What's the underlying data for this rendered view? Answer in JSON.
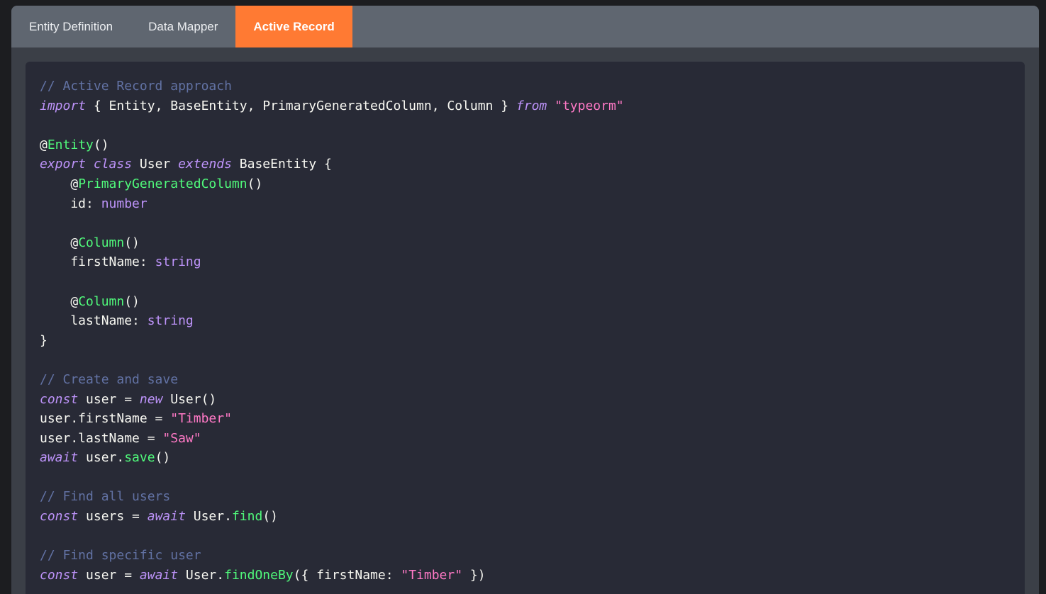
{
  "tabs": [
    {
      "label": "Entity Definition",
      "active": false
    },
    {
      "label": "Data Mapper",
      "active": false
    },
    {
      "label": "Active Record",
      "active": true
    }
  ],
  "colors": {
    "accent": "#ff7a33",
    "tabbar": "#5f6670",
    "code_bg": "#282a36",
    "comment": "#6272a4",
    "keyword": "#bd93f9",
    "string": "#ff79c6",
    "function": "#50fa7b",
    "text": "#f8f8f2"
  },
  "code": {
    "language": "typescript",
    "lines": [
      [
        {
          "t": "// Active Record approach",
          "c": "c"
        }
      ],
      [
        {
          "t": "import",
          "c": "k"
        },
        {
          "t": " { Entity, BaseEntity, PrimaryGeneratedColumn, Column } "
        },
        {
          "t": "from",
          "c": "k"
        },
        {
          "t": " "
        },
        {
          "t": "\"typeorm\"",
          "c": "s"
        }
      ],
      [],
      [
        {
          "t": "@"
        },
        {
          "t": "Entity",
          "c": "f"
        },
        {
          "t": "()"
        }
      ],
      [
        {
          "t": "export",
          "c": "k"
        },
        {
          "t": " "
        },
        {
          "t": "class",
          "c": "k"
        },
        {
          "t": " User "
        },
        {
          "t": "extends",
          "c": "k"
        },
        {
          "t": " BaseEntity {"
        }
      ],
      [
        {
          "t": "    @"
        },
        {
          "t": "PrimaryGeneratedColumn",
          "c": "f"
        },
        {
          "t": "()"
        }
      ],
      [
        {
          "t": "    id: "
        },
        {
          "t": "number",
          "c": "t"
        }
      ],
      [],
      [
        {
          "t": "    @"
        },
        {
          "t": "Column",
          "c": "f"
        },
        {
          "t": "()"
        }
      ],
      [
        {
          "t": "    firstName: "
        },
        {
          "t": "string",
          "c": "t"
        }
      ],
      [],
      [
        {
          "t": "    @"
        },
        {
          "t": "Column",
          "c": "f"
        },
        {
          "t": "()"
        }
      ],
      [
        {
          "t": "    lastName: "
        },
        {
          "t": "string",
          "c": "t"
        }
      ],
      [
        {
          "t": "}"
        }
      ],
      [],
      [
        {
          "t": "// Create and save",
          "c": "c"
        }
      ],
      [
        {
          "t": "const",
          "c": "k"
        },
        {
          "t": " user = "
        },
        {
          "t": "new",
          "c": "k"
        },
        {
          "t": " User()"
        }
      ],
      [
        {
          "t": "user.firstName = "
        },
        {
          "t": "\"Timber\"",
          "c": "s"
        }
      ],
      [
        {
          "t": "user.lastName = "
        },
        {
          "t": "\"Saw\"",
          "c": "s"
        }
      ],
      [
        {
          "t": "await",
          "c": "k"
        },
        {
          "t": " user."
        },
        {
          "t": "save",
          "c": "f"
        },
        {
          "t": "()"
        }
      ],
      [],
      [
        {
          "t": "// Find all users",
          "c": "c"
        }
      ],
      [
        {
          "t": "const",
          "c": "k"
        },
        {
          "t": " users = "
        },
        {
          "t": "await",
          "c": "k"
        },
        {
          "t": " User."
        },
        {
          "t": "find",
          "c": "f"
        },
        {
          "t": "()"
        }
      ],
      [],
      [
        {
          "t": "// Find specific user",
          "c": "c"
        }
      ],
      [
        {
          "t": "const",
          "c": "k"
        },
        {
          "t": " user = "
        },
        {
          "t": "await",
          "c": "k"
        },
        {
          "t": " User."
        },
        {
          "t": "findOneBy",
          "c": "f"
        },
        {
          "t": "({ firstName: "
        },
        {
          "t": "\"Timber\"",
          "c": "s"
        },
        {
          "t": " })"
        }
      ]
    ]
  }
}
